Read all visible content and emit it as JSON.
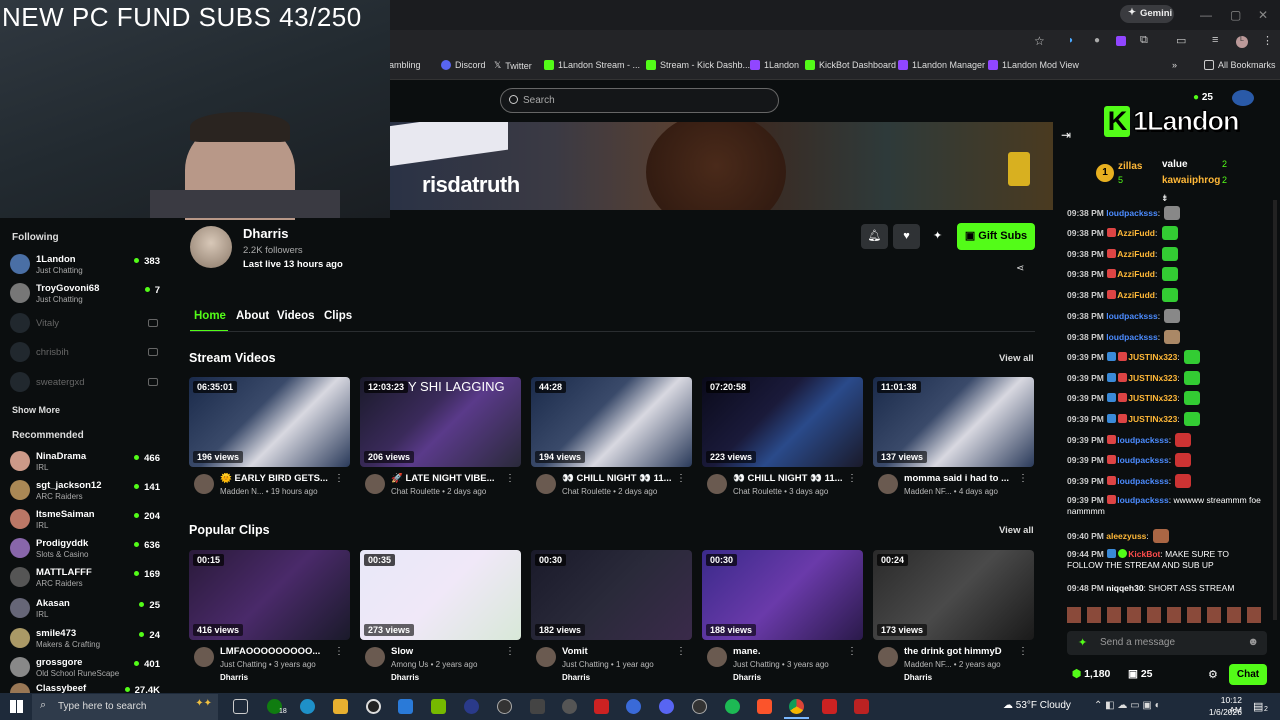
{
  "overlay": {
    "text": "NEW PC FUND SUBS 43/250"
  },
  "browser": {
    "gemini_label": "Gemini",
    "bookmarks": [
      {
        "label": "gambling",
        "color": "#888"
      },
      {
        "label": "Discord",
        "color": "#5865f2"
      },
      {
        "label": "Twitter",
        "color": "#fff"
      },
      {
        "label": "1Landon Stream - ...",
        "color": "#53fc18"
      },
      {
        "label": "Stream - Kick Dashb...",
        "color": "#53fc18"
      },
      {
        "label": "1Landon",
        "color": "#9146ff"
      },
      {
        "label": "KickBot Dashboard",
        "color": "#53fc18"
      },
      {
        "label": "1Landon Manager",
        "color": "#9146ff"
      },
      {
        "label": "1Landon Mod View",
        "color": "#9146ff"
      }
    ],
    "all_bookmarks": "All Bookmarks"
  },
  "search": {
    "placeholder": "Search"
  },
  "banner": {
    "text": "risdatruth"
  },
  "sidebar": {
    "following_title": "Following",
    "following": [
      {
        "name": "1Landon",
        "category": "Just Chatting",
        "count": "383",
        "online": true
      },
      {
        "name": "TroyGovoni68",
        "category": "Just Chatting",
        "count": "7",
        "online": true
      },
      {
        "name": "Vitaly",
        "online": false
      },
      {
        "name": "chrisbih",
        "online": false
      },
      {
        "name": "sweatergxd",
        "online": false
      }
    ],
    "show_more": "Show More",
    "recommended_title": "Recommended",
    "recommended": [
      {
        "name": "NinaDrama",
        "category": "IRL",
        "count": "466"
      },
      {
        "name": "sgt_jackson12",
        "category": "ARC Raiders",
        "count": "141"
      },
      {
        "name": "ItsmeSaiman",
        "category": "IRL",
        "count": "204"
      },
      {
        "name": "Prodigyddk",
        "category": "Slots & Casino",
        "count": "636"
      },
      {
        "name": "MATTLAFFF",
        "category": "ARC Raiders",
        "count": "169"
      },
      {
        "name": "Akasan",
        "category": "IRL",
        "count": "25"
      },
      {
        "name": "smile473",
        "category": "Makers & Crafting",
        "count": "24"
      },
      {
        "name": "grossgore",
        "category": "Old School RuneScape",
        "count": "401"
      },
      {
        "name": "Classybeef",
        "category": "",
        "count": "27.4K"
      }
    ]
  },
  "channel": {
    "name": "Dharris",
    "followers": "2.2K followers",
    "last_live": "Last live 13 hours ago",
    "gift_label": "Gift Subs",
    "tabs": [
      "Home",
      "About",
      "Videos",
      "Clips"
    ]
  },
  "stream_videos": {
    "title": "Stream Videos",
    "view_all": "View all",
    "items": [
      {
        "duration": "06:35:01",
        "views": "196 views",
        "title": "🌞 EARLY BIRD GETS...",
        "meta": "Madden N... • 19 hours ago"
      },
      {
        "duration": "12:03:23",
        "views": "206 views",
        "title": "🚀 LATE NIGHT VIBE...",
        "meta": "Chat Roulette • 2 days ago",
        "overlay": "Y SHI LAGGING"
      },
      {
        "duration": "44:28",
        "views": "194 views",
        "title": "👀 CHILL NIGHT 👀 11...",
        "meta": "Chat Roulette • 2 days ago"
      },
      {
        "duration": "07:20:58",
        "views": "223 views",
        "title": "👀 CHILL NIGHT 👀 11...",
        "meta": "Chat Roulette • 3 days ago"
      },
      {
        "duration": "11:01:38",
        "views": "137 views",
        "title": "momma said i had to ...",
        "meta": "Madden NF... • 4 days ago"
      }
    ]
  },
  "popular_clips": {
    "title": "Popular Clips",
    "view_all": "View all",
    "items": [
      {
        "duration": "00:15",
        "views": "416 views",
        "title": "LMFAOOOOOOOOO...",
        "meta": "Just Chatting • 3 years ago",
        "author": "Dharris"
      },
      {
        "duration": "00:35",
        "views": "273 views",
        "title": "Slow",
        "meta": "Among Us • 2 years ago",
        "author": "Dharris"
      },
      {
        "duration": "00:30",
        "views": "182 views",
        "title": "Vomit",
        "meta": "Just Chatting • 1 year ago",
        "author": "Dharris"
      },
      {
        "duration": "00:30",
        "views": "188 views",
        "title": "mane.",
        "meta": "Just Chatting • 3 years ago",
        "author": "Dharris"
      },
      {
        "duration": "00:24",
        "views": "173 views",
        "title": "the drink got himmyD",
        "meta": "Madden NF... • 2 years ago",
        "author": "Dharris"
      }
    ]
  },
  "chat": {
    "logo_text": "1Landon",
    "viewer_badge": "25",
    "leaderboard": [
      {
        "name": "zillas",
        "value": "5"
      },
      {
        "name": "value",
        "value": "2"
      },
      {
        "name": "kawaiiphrog",
        "value": "2"
      }
    ],
    "leader_rank": "1",
    "messages": [
      {
        "time": "09:38 PM",
        "user": "loudpacksss",
        "text": "",
        "color": "#4c8cff"
      },
      {
        "time": "09:38 PM",
        "user": "AzziFudd",
        "text": "",
        "color": "#ffb838"
      },
      {
        "time": "09:38 PM",
        "user": "AzziFudd",
        "text": "",
        "color": "#ffb838"
      },
      {
        "time": "09:38 PM",
        "user": "AzziFudd",
        "text": "",
        "color": "#ffb838"
      },
      {
        "time": "09:38 PM",
        "user": "AzziFudd",
        "text": "",
        "color": "#ffb838"
      },
      {
        "time": "09:38 PM",
        "user": "loudpacksss",
        "text": "",
        "color": "#4c8cff"
      },
      {
        "time": "09:38 PM",
        "user": "loudpacksss",
        "text": "",
        "color": "#4c8cff"
      },
      {
        "time": "09:39 PM",
        "user": "JUSTINx323",
        "text": "",
        "color": "#ffb838"
      },
      {
        "time": "09:39 PM",
        "user": "JUSTINx323",
        "text": "",
        "color": "#ffb838"
      },
      {
        "time": "09:39 PM",
        "user": "JUSTINx323",
        "text": "",
        "color": "#ffb838"
      },
      {
        "time": "09:39 PM",
        "user": "JUSTINx323",
        "text": "",
        "color": "#ffb838"
      },
      {
        "time": "09:39 PM",
        "user": "loudpacksss",
        "text": "",
        "color": "#4c8cff"
      },
      {
        "time": "09:39 PM",
        "user": "loudpacksss",
        "text": "",
        "color": "#4c8cff"
      },
      {
        "time": "09:39 PM",
        "user": "loudpacksss",
        "text": "",
        "color": "#4c8cff"
      },
      {
        "time": "09:39 PM",
        "user": "loudpacksss",
        "text": "wwwww streammm foe nammmm",
        "color": "#4c8cff"
      },
      {
        "time": "09:40 PM",
        "user": "aleezyuss",
        "text": "",
        "color": "#ffb838"
      },
      {
        "time": "09:44 PM",
        "user": "KickBot",
        "text": "MAKE SURE TO FOLLOW THE STREAM AND SUB UP",
        "color": "#ff4d4d"
      },
      {
        "time": "09:48 PM",
        "user": "niqqeh30",
        "text": "SHORT ASS STREAM",
        "color": "#fff"
      }
    ],
    "input_placeholder": "Send a message",
    "points": "1,180",
    "gifts": "25",
    "chat_button": "Chat"
  },
  "taskbar": {
    "search_placeholder": "Type here to search",
    "weather": "53°F  Cloudy",
    "time": "10:12 AM",
    "date": "1/6/2026",
    "notif_count": "2",
    "badge": "18"
  }
}
